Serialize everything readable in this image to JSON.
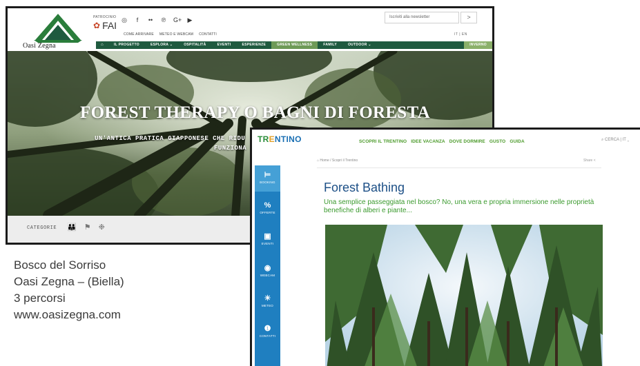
{
  "oasi": {
    "logo_text": "Oasi Zegna",
    "patrocinio": "PATROCINIO",
    "fai": "FAI",
    "social_icons": [
      "instagram-icon",
      "facebook-icon",
      "flickr-icon",
      "pinterest-icon",
      "google-plus-icon",
      "youtube-icon"
    ],
    "social_glyphs": [
      "◎",
      "f",
      "••",
      "℗",
      "G+",
      "▶"
    ],
    "links": [
      "COME ARRIVARE",
      "METEO E WEBCAM",
      "CONTATTI"
    ],
    "newsletter_placeholder": "Iscriviti alla newsletter",
    "newsletter_button": ">",
    "lang": "IT | EN",
    "nav": {
      "home": "⌂",
      "items": [
        "IL PROGETTO",
        "ESPLORA ⌄",
        "OSPITALITÀ",
        "EVENTI",
        "ESPERIENZE"
      ],
      "highlight": "GREEN WELLNESS",
      "items2": [
        "FAMILY",
        "OUTDOOR ⌄"
      ],
      "last": "INVERNO"
    },
    "hero_title": "FOREST THERAPY O BAGNI DI FORESTA",
    "hero_sub1": "UN'ANTICA PRATICA GIAPPONESE CHE RIDU",
    "hero_sub2": "FUNZIONA D",
    "categorie_label": "CATEGORIE",
    "categorie_icons": [
      "family-icon",
      "runner-icon",
      "snowflake-icon"
    ]
  },
  "caption": {
    "line1": "Bosco del Sorriso",
    "line2": "Oasi Zegna – (Biella)",
    "line3": "3 percorsi",
    "line4": "www.oasizegna.com"
  },
  "trentino": {
    "logo_part1": "TR",
    "logo_part2": "E",
    "logo_part3": "NTINO",
    "nav": [
      "SCOPRI IL TRENTINO",
      "IDEE VACANZA",
      "DOVE DORMIRE",
      "GUSTO",
      "GUIDA"
    ],
    "search": "CERCA  |  IT ⌄",
    "sidebar": [
      {
        "icon": "bed-icon",
        "glyph": "⊨",
        "label": "BOOKING"
      },
      {
        "icon": "percent-icon",
        "glyph": "%",
        "label": "OFFERTE"
      },
      {
        "icon": "calendar-icon",
        "glyph": "▣",
        "label": "EVENTI"
      },
      {
        "icon": "webcam-icon",
        "glyph": "◉",
        "label": "WEBCAM"
      },
      {
        "icon": "weather-icon",
        "glyph": "☀",
        "label": "METEO"
      },
      {
        "icon": "contact-icon",
        "glyph": "❶",
        "label": "CONTATTI"
      }
    ],
    "breadcrumb": "⌂ Home  /  Scopri il Trentino",
    "share": "Share <",
    "title": "Forest Bathing",
    "subtitle": "Una semplice passeggiata nel bosco? No, una vera e propria immersione nelle proprietà benefiche di alberi e piante..."
  },
  "colors": {
    "oasi_green": "#1f5a3f",
    "trentino_blue": "#1f7fc0",
    "trentino_green": "#4b9a2a",
    "title_blue": "#1c4f86"
  }
}
